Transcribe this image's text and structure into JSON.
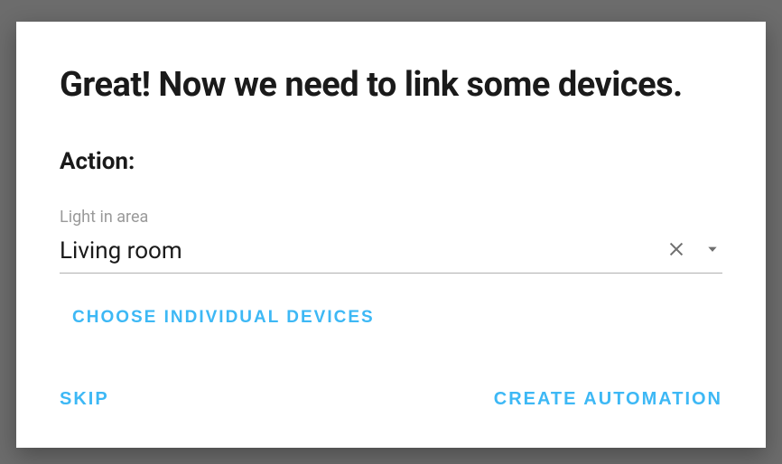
{
  "dialog": {
    "title": "Great! Now we need to link some devices.",
    "action_label": "Action:",
    "field": {
      "label": "Light in area",
      "value": "Living room"
    },
    "choose_devices_label": "CHOOSE INDIVIDUAL DEVICES",
    "skip_label": "SKIP",
    "create_label": "CREATE AUTOMATION"
  }
}
